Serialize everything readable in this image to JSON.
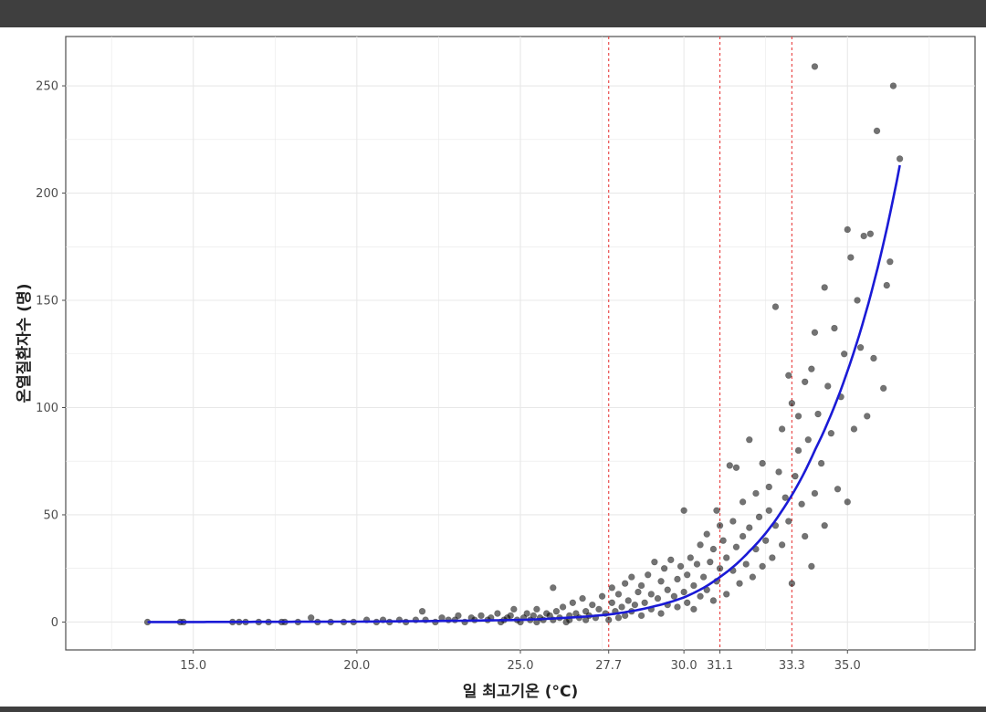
{
  "colors": {
    "topbar": "#3f3f3f",
    "panel_border": "#4d4d4d",
    "grid": "#e8e8e8",
    "points": "#000000",
    "curve": "#1a1ad6",
    "thresholds": "#e83c3c"
  },
  "chart_data": {
    "type": "scatter",
    "title": "",
    "xlabel": "일 최고기온 (°C)",
    "ylabel": "온열질환자수 (명)",
    "xlim": [
      11.1,
      38.9
    ],
    "ylim": [
      -13,
      273
    ],
    "grid": true,
    "x_ticks": [
      15.0,
      20.0,
      25.0,
      27.7,
      30.0,
      31.1,
      33.3,
      35.0
    ],
    "x_tick_labels": [
      "15.0",
      "20.0",
      "25.0",
      "27.7",
      "30.0",
      "31.1",
      "33.3",
      "35.0"
    ],
    "y_ticks": [
      0,
      50,
      100,
      150,
      200,
      250
    ],
    "y_tick_labels": [
      "0",
      "50",
      "100",
      "150",
      "200",
      "250"
    ],
    "threshold_lines_x": [
      27.7,
      31.1,
      33.3
    ],
    "fit_curve": {
      "type": "exponential",
      "x": [
        13.6,
        20.0,
        25.0,
        27.7,
        29.0,
        30.0,
        31.1,
        32.0,
        33.0,
        34.0,
        35.0,
        36.0,
        36.6
      ],
      "y": [
        0.0,
        0.2,
        1.0,
        3.5,
        7.0,
        11.5,
        21.0,
        33.0,
        52.0,
        80.0,
        117.0,
        170.0,
        213.0
      ]
    },
    "points": [
      [
        13.6,
        0
      ],
      [
        14.6,
        0
      ],
      [
        14.7,
        0
      ],
      [
        16.2,
        0
      ],
      [
        16.4,
        0
      ],
      [
        16.6,
        0
      ],
      [
        17.0,
        0
      ],
      [
        17.3,
        0
      ],
      [
        17.7,
        0
      ],
      [
        17.8,
        0
      ],
      [
        18.2,
        0
      ],
      [
        18.6,
        2
      ],
      [
        18.8,
        0
      ],
      [
        19.2,
        0
      ],
      [
        19.6,
        0
      ],
      [
        19.9,
        0
      ],
      [
        20.3,
        1
      ],
      [
        20.6,
        0
      ],
      [
        20.8,
        1
      ],
      [
        21.0,
        0
      ],
      [
        21.3,
        1
      ],
      [
        21.5,
        0
      ],
      [
        21.8,
        1
      ],
      [
        22.0,
        5
      ],
      [
        22.1,
        1
      ],
      [
        22.4,
        0
      ],
      [
        22.6,
        2
      ],
      [
        22.8,
        1
      ],
      [
        23.0,
        1
      ],
      [
        23.1,
        3
      ],
      [
        23.3,
        0
      ],
      [
        23.5,
        2
      ],
      [
        23.6,
        1
      ],
      [
        23.8,
        3
      ],
      [
        24.0,
        1
      ],
      [
        24.1,
        2
      ],
      [
        24.3,
        4
      ],
      [
        24.4,
        0
      ],
      [
        24.5,
        1
      ],
      [
        24.6,
        2
      ],
      [
        24.7,
        3
      ],
      [
        24.8,
        6
      ],
      [
        24.9,
        1
      ],
      [
        25.0,
        0
      ],
      [
        25.1,
        2
      ],
      [
        25.2,
        4
      ],
      [
        25.3,
        1
      ],
      [
        25.4,
        3
      ],
      [
        25.5,
        0
      ],
      [
        25.5,
        6
      ],
      [
        25.6,
        2
      ],
      [
        25.7,
        1
      ],
      [
        25.8,
        4
      ],
      [
        25.9,
        3
      ],
      [
        26.0,
        1
      ],
      [
        26.0,
        16
      ],
      [
        26.1,
        5
      ],
      [
        26.2,
        2
      ],
      [
        26.3,
        7
      ],
      [
        26.4,
        0
      ],
      [
        26.5,
        3
      ],
      [
        26.5,
        1
      ],
      [
        26.6,
        9
      ],
      [
        26.7,
        4
      ],
      [
        26.8,
        2
      ],
      [
        26.9,
        11
      ],
      [
        27.0,
        5
      ],
      [
        27.0,
        1
      ],
      [
        27.1,
        3
      ],
      [
        27.2,
        8
      ],
      [
        27.3,
        2
      ],
      [
        27.4,
        6
      ],
      [
        27.5,
        12
      ],
      [
        27.6,
        4
      ],
      [
        27.7,
        1
      ],
      [
        27.8,
        9
      ],
      [
        27.8,
        16
      ],
      [
        27.9,
        5
      ],
      [
        28.0,
        2
      ],
      [
        28.0,
        13
      ],
      [
        28.1,
        7
      ],
      [
        28.2,
        3
      ],
      [
        28.2,
        18
      ],
      [
        28.3,
        10
      ],
      [
        28.4,
        5
      ],
      [
        28.4,
        21
      ],
      [
        28.5,
        8
      ],
      [
        28.6,
        14
      ],
      [
        28.7,
        3
      ],
      [
        28.7,
        17
      ],
      [
        28.8,
        9
      ],
      [
        28.9,
        22
      ],
      [
        29.0,
        6
      ],
      [
        29.0,
        13
      ],
      [
        29.1,
        28
      ],
      [
        29.2,
        11
      ],
      [
        29.3,
        4
      ],
      [
        29.3,
        19
      ],
      [
        29.4,
        25
      ],
      [
        29.5,
        8
      ],
      [
        29.5,
        15
      ],
      [
        29.6,
        29
      ],
      [
        29.7,
        12
      ],
      [
        29.8,
        20
      ],
      [
        29.8,
        7
      ],
      [
        29.9,
        26
      ],
      [
        30.0,
        14
      ],
      [
        30.0,
        52
      ],
      [
        30.1,
        9
      ],
      [
        30.1,
        22
      ],
      [
        30.2,
        30
      ],
      [
        30.3,
        17
      ],
      [
        30.3,
        6
      ],
      [
        30.4,
        27
      ],
      [
        30.5,
        12
      ],
      [
        30.5,
        36
      ],
      [
        30.6,
        21
      ],
      [
        30.7,
        15
      ],
      [
        30.7,
        41
      ],
      [
        30.8,
        28
      ],
      [
        30.9,
        10
      ],
      [
        30.9,
        34
      ],
      [
        31.0,
        19
      ],
      [
        31.0,
        52
      ],
      [
        31.1,
        25
      ],
      [
        31.1,
        45
      ],
      [
        31.2,
        38
      ],
      [
        31.3,
        13
      ],
      [
        31.3,
        30
      ],
      [
        31.4,
        73
      ],
      [
        31.5,
        24
      ],
      [
        31.5,
        47
      ],
      [
        31.6,
        72
      ],
      [
        31.6,
        35
      ],
      [
        31.7,
        18
      ],
      [
        31.8,
        40
      ],
      [
        31.8,
        56
      ],
      [
        31.9,
        27
      ],
      [
        32.0,
        85
      ],
      [
        32.0,
        44
      ],
      [
        32.1,
        21
      ],
      [
        32.2,
        60
      ],
      [
        32.2,
        34
      ],
      [
        32.3,
        49
      ],
      [
        32.4,
        74
      ],
      [
        32.4,
        26
      ],
      [
        32.5,
        38
      ],
      [
        32.6,
        63
      ],
      [
        32.6,
        52
      ],
      [
        32.7,
        30
      ],
      [
        32.8,
        45
      ],
      [
        32.8,
        147
      ],
      [
        32.9,
        70
      ],
      [
        33.0,
        36
      ],
      [
        33.0,
        90
      ],
      [
        33.1,
        58
      ],
      [
        33.2,
        115
      ],
      [
        33.2,
        47
      ],
      [
        33.3,
        102
      ],
      [
        33.3,
        18
      ],
      [
        33.4,
        68
      ],
      [
        33.5,
        80
      ],
      [
        33.5,
        96
      ],
      [
        33.6,
        55
      ],
      [
        33.7,
        112
      ],
      [
        33.7,
        40
      ],
      [
        33.8,
        85
      ],
      [
        33.9,
        26
      ],
      [
        33.9,
        118
      ],
      [
        34.0,
        60
      ],
      [
        34.0,
        135
      ],
      [
        34.0,
        259
      ],
      [
        34.1,
        97
      ],
      [
        34.2,
        74
      ],
      [
        34.3,
        156
      ],
      [
        34.3,
        45
      ],
      [
        34.4,
        110
      ],
      [
        34.5,
        88
      ],
      [
        34.6,
        137
      ],
      [
        34.7,
        62
      ],
      [
        34.8,
        105
      ],
      [
        34.9,
        125
      ],
      [
        35.0,
        183
      ],
      [
        35.0,
        56
      ],
      [
        35.1,
        170
      ],
      [
        35.2,
        90
      ],
      [
        35.3,
        150
      ],
      [
        35.4,
        128
      ],
      [
        35.5,
        180
      ],
      [
        35.6,
        96
      ],
      [
        35.7,
        181
      ],
      [
        35.8,
        123
      ],
      [
        35.9,
        229
      ],
      [
        36.1,
        109
      ],
      [
        36.2,
        157
      ],
      [
        36.3,
        168
      ],
      [
        36.4,
        250
      ],
      [
        36.6,
        216
      ]
    ]
  }
}
